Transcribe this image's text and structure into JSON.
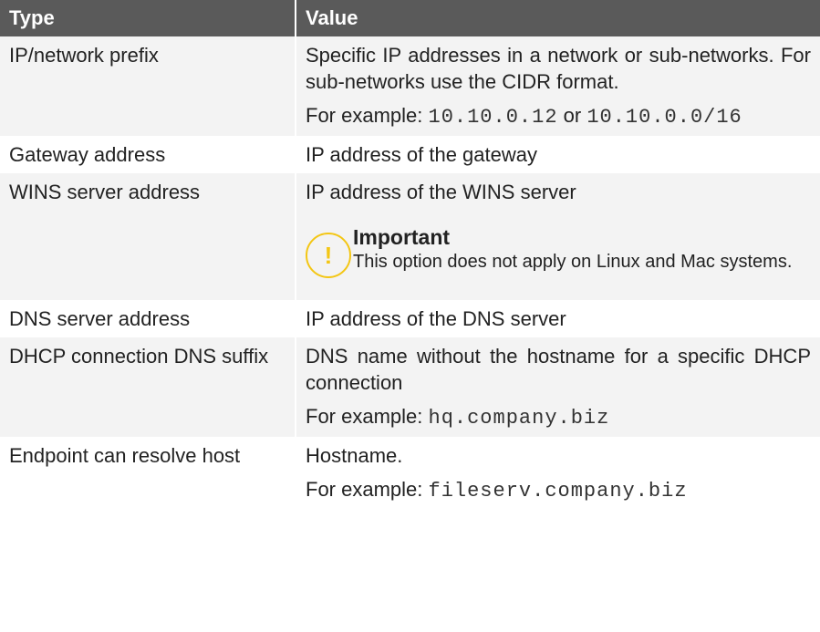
{
  "table": {
    "headers": [
      "Type",
      "Value"
    ],
    "rows": [
      {
        "type": "IP/network prefix",
        "description": "Specific IP addresses in a network or sub-networks. For sub-networks use the CIDR format.",
        "example_prefix": "For example: ",
        "example_code": "10.10.0.12",
        "example_or": " or ",
        "example_code2": "10.10.0.0/16"
      },
      {
        "type": "Gateway address",
        "description": "IP address of the gateway"
      },
      {
        "type": "WINS server address",
        "description": "IP address of the WINS server",
        "note": {
          "icon": "!",
          "title": "Important",
          "text": "This option does not apply on Linux and Mac systems."
        }
      },
      {
        "type": "DNS server address",
        "description": "IP address of the DNS server"
      },
      {
        "type": "DHCP connection DNS suffix",
        "description": "DNS name without the hostname for a specific DHCP connection",
        "example_prefix": "For example: ",
        "example_code": "hq.company.biz"
      },
      {
        "type": "Endpoint can resolve host",
        "description": "Hostname.",
        "example_prefix": "For example: ",
        "example_code": "fileserv.company.biz"
      }
    ]
  }
}
